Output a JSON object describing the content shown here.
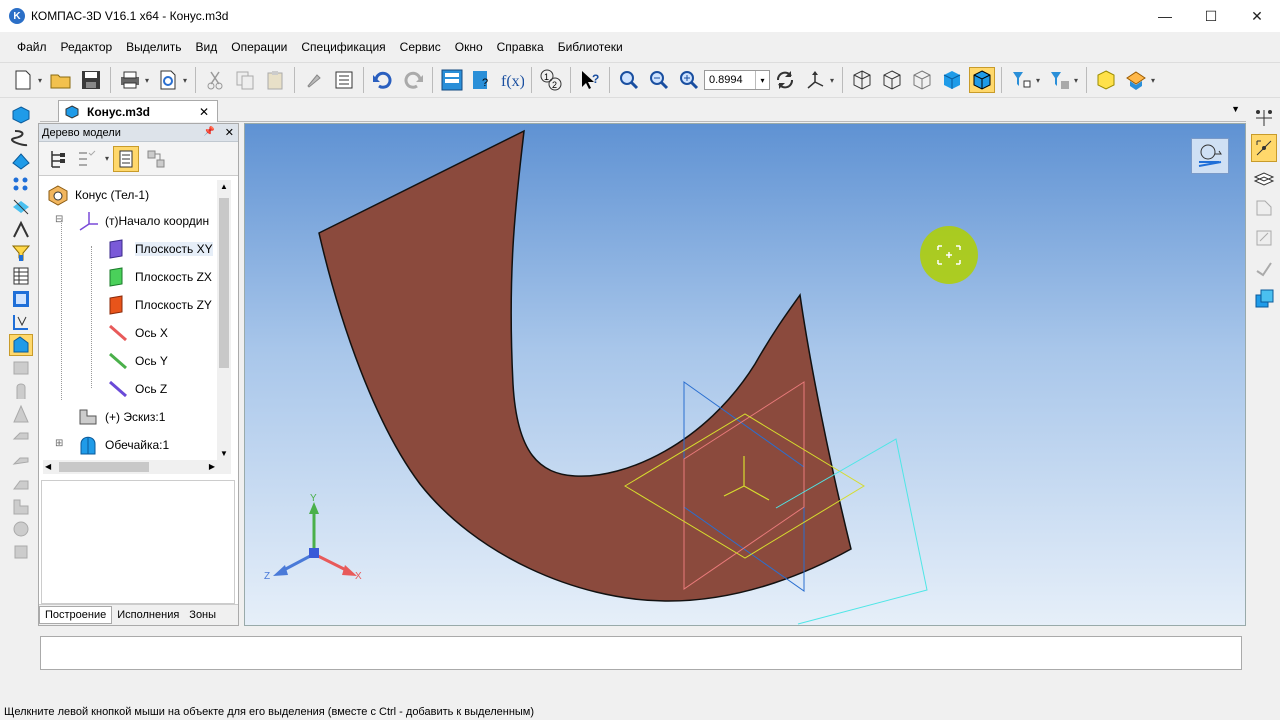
{
  "window": {
    "title": "КОМПАС-3D V16.1 x64 - Конус.m3d",
    "min": "—",
    "max": "☐",
    "close": "✕",
    "app_icon": "K"
  },
  "menu": [
    "Файл",
    "Редактор",
    "Выделить",
    "Вид",
    "Операции",
    "Спецификация",
    "Сервис",
    "Окно",
    "Справка",
    "Библиотеки"
  ],
  "toolbar": {
    "zoom_value": "0.8994",
    "zoom_arrow": "▾",
    "dropdown_arrow": "▾"
  },
  "doc_tabs": [
    {
      "label": "Конус.m3d",
      "close": "✕"
    }
  ],
  "tabs_dropdown": "▼",
  "tree_panel": {
    "title": "Дерево модели",
    "pin": "📌",
    "close": "✕",
    "nodes": [
      {
        "label": "Конус (Тел-1)"
      },
      {
        "label": "(т)Начало координ"
      },
      {
        "label": "Плоскость XY"
      },
      {
        "label": "Плоскость ZX"
      },
      {
        "label": "Плоскость ZY"
      },
      {
        "label": "Ось X"
      },
      {
        "label": "Ось Y"
      },
      {
        "label": "Ось Z"
      },
      {
        "label": "(+) Эскиз:1"
      },
      {
        "label": "Обечайка:1"
      }
    ],
    "expand_minus": "⊟",
    "expand_plus": "⊞",
    "scroll_up": "▲",
    "scroll_down": "▼",
    "scroll_left": "◀",
    "scroll_right": "▶",
    "bottom_tabs": [
      "Построение",
      "Исполнения",
      "Зоны"
    ]
  },
  "viewport": {
    "axis_labels": {
      "x": "X",
      "y": "Y",
      "z": "Z"
    },
    "colors": {
      "model_fill": "#8b4a3d",
      "plane_xy": "#d6dc2e",
      "plane_zx": "#e87a7a",
      "plane_zy": "#2a6fd0",
      "sketch_plane": "#4fe6e6",
      "cursor": "#b0d000"
    }
  },
  "status": {
    "text": "Щелкните левой кнопкой мыши на объекте для его выделения (вместе с Ctrl - добавить к выделенным)"
  }
}
